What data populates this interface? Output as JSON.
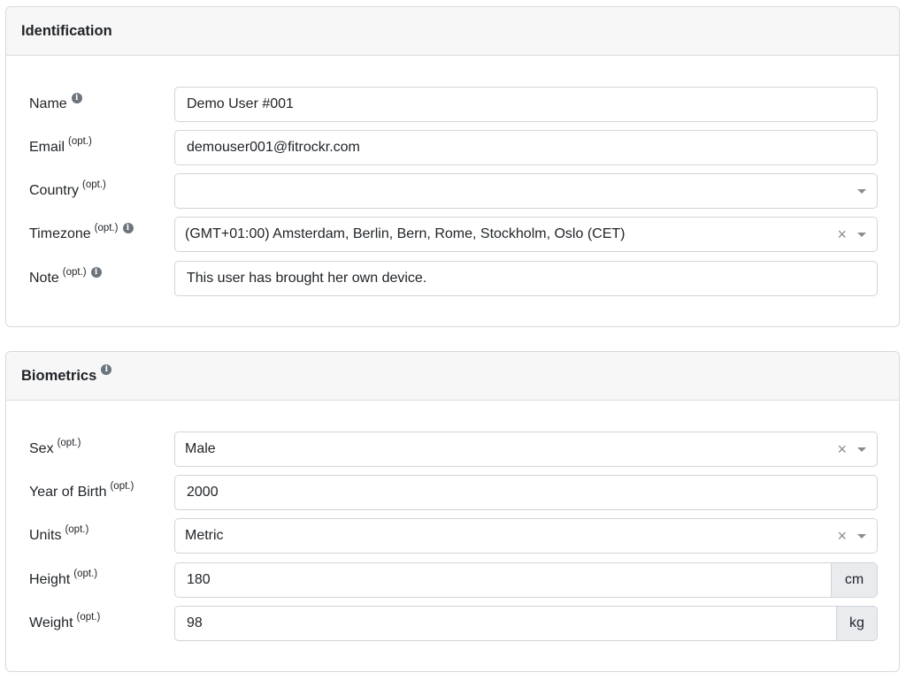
{
  "identification": {
    "title": "Identification",
    "name": {
      "label": "Name",
      "value": "Demo User #001"
    },
    "email": {
      "label": "Email",
      "opt": "(opt.)",
      "value": "demouser001@fitrockr.com"
    },
    "country": {
      "label": "Country",
      "opt": "(opt.)",
      "value": ""
    },
    "timezone": {
      "label": "Timezone",
      "opt": "(opt.)",
      "value": "(GMT+01:00) Amsterdam, Berlin, Bern, Rome, Stockholm, Oslo (CET)"
    },
    "note": {
      "label": "Note",
      "opt": "(opt.)",
      "value": "This user has brought her own device."
    }
  },
  "biometrics": {
    "title": "Biometrics",
    "sex": {
      "label": "Sex",
      "opt": "(opt.)",
      "value": "Male"
    },
    "year_of_birth": {
      "label": "Year of Birth",
      "opt": "(opt.)",
      "value": "2000"
    },
    "units": {
      "label": "Units",
      "opt": "(opt.)",
      "value": "Metric"
    },
    "height": {
      "label": "Height",
      "opt": "(opt.)",
      "value": "180",
      "unit": "cm"
    },
    "weight": {
      "label": "Weight",
      "opt": "(opt.)",
      "value": "98",
      "unit": "kg"
    }
  },
  "icons": {
    "info": "i",
    "clear": "×"
  }
}
